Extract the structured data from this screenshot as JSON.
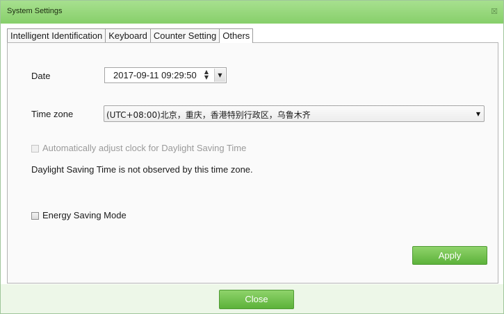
{
  "window": {
    "title": "System Settings",
    "close_glyph": "☒"
  },
  "tabs": [
    {
      "label": "Intelligent Identification",
      "active": false
    },
    {
      "label": "Keyboard",
      "active": false
    },
    {
      "label": "Counter Setting",
      "active": false
    },
    {
      "label": "Others",
      "active": true
    }
  ],
  "others": {
    "date_label": "Date",
    "date_value": "2017-09-11 09:29:50",
    "timezone_label": "Time zone",
    "timezone_value": "(UTC+08:00)北京，重庆，香港特别行政区，乌鲁木齐",
    "dst_checkbox_label": "Automatically adjust clock for Daylight Saving Time",
    "dst_checked": false,
    "dst_enabled": false,
    "dst_note": "Daylight Saving Time is not observed by this time zone.",
    "energy_checkbox_label": "Energy Saving Mode",
    "energy_checked": false,
    "apply_label": "Apply"
  },
  "footer": {
    "close_label": "Close"
  },
  "colors": {
    "title_bar": "#95d678",
    "button_green": "#6cc046",
    "footer_bg": "#edf7e8"
  }
}
